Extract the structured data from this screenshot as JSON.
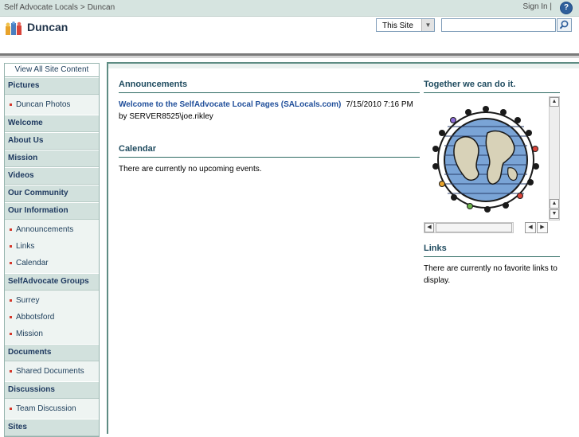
{
  "topbar": {
    "breadcrumb": [
      "Self Advocate Locals",
      "Duncan"
    ],
    "breadcrumb_sep": ">",
    "signin": "Sign In |",
    "help_icon": "help-icon"
  },
  "header": {
    "site_title": "Duncan",
    "scope_value": "This Site",
    "search_value": ""
  },
  "leftnav": {
    "view_all": "View All Site Content",
    "sections": [
      {
        "label": "Pictures",
        "items": [
          "Duncan Photos"
        ]
      },
      {
        "label": "Welcome",
        "items": []
      },
      {
        "label": "About Us",
        "items": []
      },
      {
        "label": "Mission",
        "items": []
      },
      {
        "label": "Videos",
        "items": []
      },
      {
        "label": "Our Community",
        "items": []
      },
      {
        "label": "Our Information",
        "items": [
          "Announcements",
          "Links",
          "Calendar"
        ]
      },
      {
        "label": "SelfAdvocate Groups",
        "items": [
          "Surrey",
          "Abbotsford",
          "Mission"
        ]
      },
      {
        "label": "Documents",
        "items": [
          "Shared Documents"
        ]
      },
      {
        "label": "Discussions",
        "items": [
          "Team Discussion"
        ]
      },
      {
        "label": "Sites",
        "items": []
      }
    ]
  },
  "announcements": {
    "title": "Announcements",
    "item_title": "Welcome to the SelfAdvocate Local Pages (SALocals.com)",
    "item_date": "7/15/2010 7:16 PM",
    "item_by": "by SERVER8525\\joe.rikley"
  },
  "calendar": {
    "title": "Calendar",
    "empty": "There are currently no upcoming events."
  },
  "image_web_part": {
    "title": "Together we can do it."
  },
  "links": {
    "title": "Links",
    "empty": "There are currently no favorite links to display."
  },
  "colors": {
    "topbar": "#d6e4e0",
    "nav_bg": "#e7efed",
    "accent": "#2f6b63",
    "link": "#1f4e9a",
    "bullet": "#d4372a"
  }
}
